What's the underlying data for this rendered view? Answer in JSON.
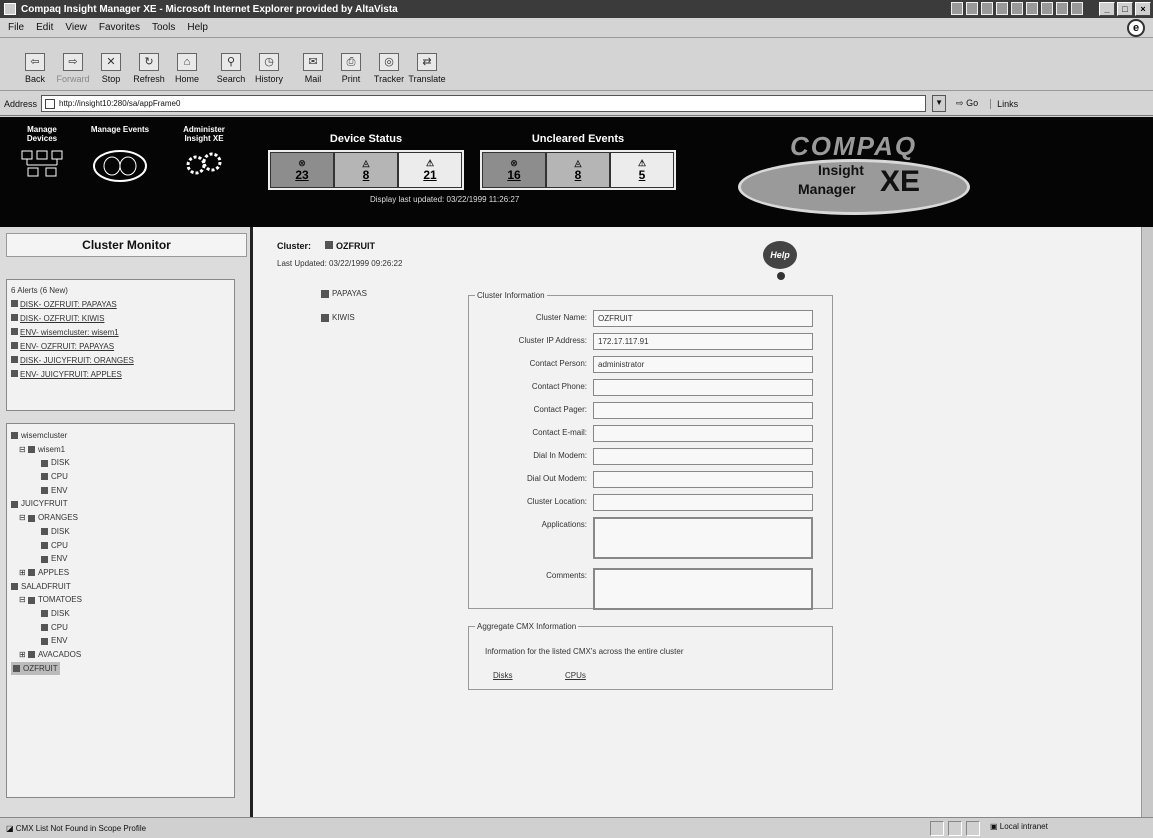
{
  "window": {
    "title": "Compaq Insight Manager XE - Microsoft Internet Explorer provided by AltaVista"
  },
  "menu": [
    "File",
    "Edit",
    "View",
    "Favorites",
    "Tools",
    "Help"
  ],
  "toolbar": [
    {
      "label": "Back",
      "icon": "back-arrow"
    },
    {
      "label": "Forward",
      "icon": "forward-arrow"
    },
    {
      "label": "Stop",
      "icon": "stop"
    },
    {
      "label": "Refresh",
      "icon": "refresh"
    },
    {
      "label": "Home",
      "icon": "home"
    },
    {
      "label": "Search",
      "icon": "search"
    },
    {
      "label": "History",
      "icon": "history"
    },
    {
      "label": "Mail",
      "icon": "mail"
    },
    {
      "label": "Print",
      "icon": "print"
    },
    {
      "label": "Tracker",
      "icon": "tracker"
    },
    {
      "label": "Translate",
      "icon": "translate"
    }
  ],
  "address": {
    "label": "Address",
    "url": "http://insight10:280/sa/appFrame0",
    "go": "Go",
    "links": "Links"
  },
  "banner": {
    "nav": [
      {
        "label": "Manage Devices"
      },
      {
        "label": "Manage Events"
      },
      {
        "label": "Administer Insight XE"
      }
    ],
    "device_status": {
      "title": "Device Status",
      "values": [
        "23",
        "8",
        "21"
      ]
    },
    "uncleared_events": {
      "title": "Uncleared Events",
      "values": [
        "16",
        "8",
        "5"
      ]
    },
    "display_updated": "Display last updated: 03/22/1999 11:26:27",
    "logo": {
      "brand": "COMPAQ",
      "line1": "Insight",
      "line2": "Manager",
      "line3": "XE"
    }
  },
  "left_panel": {
    "title": "Cluster Monitor",
    "alerts": {
      "header": "6 Alerts (6 New)",
      "items": [
        "DISK- OZFRUIT: PAPAYAS",
        "DISK- OZFRUIT: KIWIS",
        "ENV- wisemcluster: wisem1",
        "ENV- OZFRUIT: PAPAYAS",
        "DISK- JUICYFRUIT: ORANGES",
        "ENV- JUICYFRUIT: APPLES"
      ]
    },
    "tree": [
      {
        "label": "wisemcluster",
        "depth": 0
      },
      {
        "label": "wisem1",
        "depth": 1
      },
      {
        "label": "DISK",
        "depth": 2
      },
      {
        "label": "CPU",
        "depth": 2
      },
      {
        "label": "ENV",
        "depth": 2
      },
      {
        "label": "JUICYFRUIT",
        "depth": 0
      },
      {
        "label": "ORANGES",
        "depth": 1
      },
      {
        "label": "DISK",
        "depth": 2
      },
      {
        "label": "CPU",
        "depth": 2
      },
      {
        "label": "ENV",
        "depth": 2
      },
      {
        "label": "APPLES",
        "depth": 1
      },
      {
        "label": "SALADFRUIT",
        "depth": 0
      },
      {
        "label": "TOMATOES",
        "depth": 1
      },
      {
        "label": "DISK",
        "depth": 2
      },
      {
        "label": "CPU",
        "depth": 2
      },
      {
        "label": "ENV",
        "depth": 2
      },
      {
        "label": "AVACADOS",
        "depth": 1
      },
      {
        "label": "OZFRUIT",
        "depth": 0,
        "selected": true
      }
    ]
  },
  "main": {
    "cluster_label": "Cluster:",
    "cluster_name": "OZFRUIT",
    "last_updated": "Last Updated: 03/22/1999 09:26:22",
    "nodes": [
      "PAPAYAS",
      "KIWIS"
    ],
    "help": "Help",
    "cluster_info": {
      "legend": "Cluster Information",
      "fields": [
        {
          "label": "Cluster Name:",
          "value": "OZFRUIT"
        },
        {
          "label": "Cluster IP Address:",
          "value": "172.17.117.91"
        },
        {
          "label": "Contact Person:",
          "value": "administrator"
        },
        {
          "label": "Contact Phone:",
          "value": ""
        },
        {
          "label": "Contact Pager:",
          "value": ""
        },
        {
          "label": "Contact E-mail:",
          "value": ""
        },
        {
          "label": "Dial In Modem:",
          "value": ""
        },
        {
          "label": "Dial Out Modem:",
          "value": ""
        },
        {
          "label": "Cluster Location:",
          "value": ""
        },
        {
          "label": "Applications:",
          "value": ""
        },
        {
          "label": "Comments:",
          "value": ""
        }
      ]
    },
    "aggregate": {
      "legend": "Aggregate CMX Information",
      "text": "Information for the listed CMX's across the entire cluster",
      "links": [
        "Disks",
        "CPUs"
      ]
    }
  },
  "statusbar": {
    "message": "CMX List Not Found in Scope Profile",
    "zone": "Local intranet"
  }
}
